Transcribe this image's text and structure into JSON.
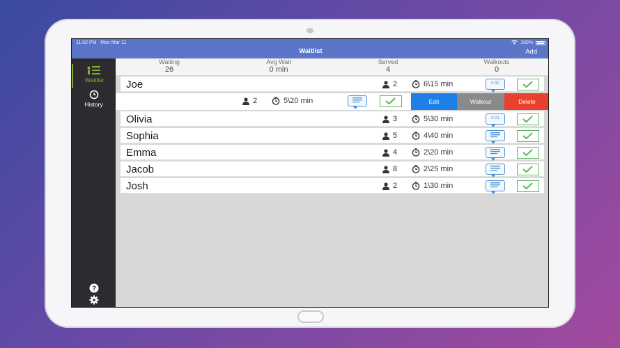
{
  "status_bar": {
    "time": "11:02 PM",
    "date": "Mon Mar 11",
    "battery": "100%"
  },
  "topbar": {
    "title": "Waitlist",
    "add_label": "Add"
  },
  "sidebar": {
    "items": [
      {
        "label": "Waitlist",
        "icon": "waitlist-icon",
        "active": true
      },
      {
        "label": "History",
        "icon": "history-icon",
        "active": false
      }
    ],
    "bottom_icons": [
      "help-icon",
      "gear-icon"
    ]
  },
  "stats": [
    {
      "label": "Waiting",
      "value": "26"
    },
    {
      "label": "Avg Wait",
      "value": "0 min"
    },
    {
      "label": "Served",
      "value": "4"
    },
    {
      "label": "Walkouts",
      "value": "0"
    }
  ],
  "rows": [
    {
      "name": "Joe",
      "party": "2",
      "wait": "6\\15 min",
      "msg_time": "0:32"
    },
    {
      "name": "",
      "party": "2",
      "wait": "5\\20 min",
      "msg_time": "",
      "swiped": true,
      "actions": {
        "edit": "Edit",
        "walkout": "Walkout",
        "delete": "Delete"
      }
    },
    {
      "name": "Olivia",
      "party": "3",
      "wait": "5\\30 min",
      "msg_time": "0:21"
    },
    {
      "name": "Sophia",
      "party": "5",
      "wait": "4\\40 min",
      "msg_time": ""
    },
    {
      "name": "Emma",
      "party": "4",
      "wait": "2\\20 min",
      "msg_time": ""
    },
    {
      "name": "Jacob",
      "party": "8",
      "wait": "2\\25 min",
      "msg_time": ""
    },
    {
      "name": "Josh",
      "party": "2",
      "wait": "1\\30 min",
      "msg_time": ""
    }
  ],
  "colors": {
    "header": "#5b76c8",
    "sidebar": "#2d2b2f",
    "accent_green": "#84ad34",
    "edit": "#1e7fe6",
    "walkout": "#8a8a8a",
    "delete": "#e8412f",
    "check": "#5cb85c",
    "message": "#4a90d6"
  }
}
